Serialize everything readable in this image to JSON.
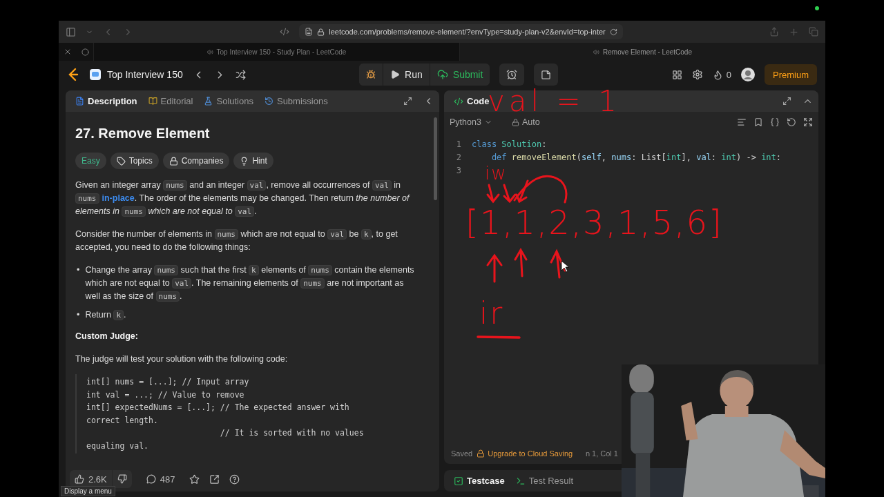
{
  "browser": {
    "url": "leetcode.com/problems/remove-element/?envType=study-plan-v2&envId=top-inter",
    "tabs": [
      {
        "title": "Top Interview 150 - Study Plan - LeetCode",
        "selected": false
      },
      {
        "title": "Remove Element - LeetCode",
        "selected": true
      }
    ]
  },
  "header": {
    "list_title": "Top Interview 150",
    "run": "Run",
    "submit": "Submit",
    "streak": "0",
    "premium": "Premium"
  },
  "description_panel": {
    "tabs": [
      {
        "label": "Description",
        "kind": "description",
        "selected": true
      },
      {
        "label": "Editorial",
        "kind": "editorial",
        "selected": false
      },
      {
        "label": "Solutions",
        "kind": "solutions",
        "selected": false
      },
      {
        "label": "Submissions",
        "kind": "submissions",
        "selected": false
      }
    ],
    "title": "27. Remove Element",
    "tags": [
      {
        "label": "Easy",
        "kind": "difficulty"
      },
      {
        "label": "Topics",
        "kind": "topics"
      },
      {
        "label": "Companies",
        "kind": "companies"
      },
      {
        "label": "Hint",
        "kind": "hint"
      }
    ],
    "paragraphs": [
      [
        {
          "kind": "text",
          "t": "Given an integer array "
        },
        {
          "kind": "code",
          "t": "nums"
        },
        {
          "kind": "text",
          "t": " and an integer "
        },
        {
          "kind": "code",
          "t": "val"
        },
        {
          "kind": "text",
          "t": ", remove all occurrences of "
        },
        {
          "kind": "code",
          "t": "val"
        },
        {
          "kind": "text",
          "t": " in "
        },
        {
          "kind": "code",
          "t": "nums"
        },
        {
          "kind": "link",
          "t": "in-place"
        },
        {
          "kind": "text",
          "t": ". The order of the elements may be changed. Then return "
        },
        {
          "kind": "italic",
          "t": "the number of elements in "
        },
        {
          "kind": "code",
          "t": "nums"
        },
        {
          "kind": "italic",
          "t": " which are not equal to "
        },
        {
          "kind": "code",
          "t": "val"
        },
        {
          "kind": "text",
          "t": "."
        }
      ],
      [
        {
          "kind": "text",
          "t": "Consider the number of elements in "
        },
        {
          "kind": "code",
          "t": "nums"
        },
        {
          "kind": "text",
          "t": " which are not equal to "
        },
        {
          "kind": "code",
          "t": "val"
        },
        {
          "kind": "text",
          "t": " be "
        },
        {
          "kind": "code",
          "t": "k"
        },
        {
          "kind": "text",
          "t": ", to get accepted, you need to do the following things:"
        }
      ]
    ],
    "bullets": [
      {
        "marker": "•",
        "segs": [
          {
            "kind": "text",
            "t": "Change the array "
          },
          {
            "kind": "code",
            "t": "nums"
          },
          {
            "kind": "text",
            "t": " such that the first "
          },
          {
            "kind": "code",
            "t": "k"
          },
          {
            "kind": "text",
            "t": " elements of "
          },
          {
            "kind": "code",
            "t": "nums"
          },
          {
            "kind": "text",
            "t": " contain the elements which are not equal to "
          },
          {
            "kind": "code",
            "t": "val"
          },
          {
            "kind": "text",
            "t": ". The remaining elements of "
          },
          {
            "kind": "code",
            "t": "nums"
          },
          {
            "kind": "text",
            "t": " are not important as well as the size of "
          },
          {
            "kind": "code",
            "t": "nums"
          },
          {
            "kind": "text",
            "t": "."
          }
        ]
      },
      {
        "marker": "•",
        "segs": [
          {
            "kind": "text",
            "t": "Return "
          },
          {
            "kind": "code",
            "t": "k"
          },
          {
            "kind": "text",
            "t": "."
          }
        ]
      }
    ],
    "subheading": "Custom Judge:",
    "judge_intro": "The judge will test your solution with the following code:",
    "judge_code": [
      "int[] nums = [...]; // Input array",
      "int val = ...; // Value to remove",
      "int[] expectedNums = [...]; // The expected answer with",
      "correct length.",
      "                            // It is sorted with no values",
      "equaling val."
    ],
    "likes": "2.6K",
    "comments": "487"
  },
  "code_panel": {
    "tab": "Code",
    "language": "Python3",
    "mode": "Auto",
    "lines": [
      {
        "number": "1",
        "tokens": [
          {
            "kind": "keyword",
            "t": "class "
          },
          {
            "kind": "type",
            "t": "Solution"
          },
          {
            "kind": "plain",
            "t": ":"
          }
        ]
      },
      {
        "number": "2",
        "tokens": [
          {
            "kind": "keyword",
            "t": "    def "
          },
          {
            "kind": "func",
            "t": "removeElement"
          },
          {
            "kind": "plain",
            "t": "("
          },
          {
            "kind": "param",
            "t": "self"
          },
          {
            "kind": "plain",
            "t": ", "
          },
          {
            "kind": "param",
            "t": "nums"
          },
          {
            "kind": "plain",
            "t": ": List["
          },
          {
            "kind": "type",
            "t": "int"
          },
          {
            "kind": "plain",
            "t": "], "
          },
          {
            "kind": "param",
            "t": "val"
          },
          {
            "kind": "plain",
            "t": ": "
          },
          {
            "kind": "type",
            "t": "int"
          },
          {
            "kind": "plain",
            "t": ") -> "
          },
          {
            "kind": "type",
            "t": "int"
          },
          {
            "kind": "plain",
            "t": ":"
          }
        ]
      },
      {
        "number": "3"
      }
    ],
    "saved": "Saved",
    "upgrade": "Upgrade to Cloud Saving",
    "cursor": "n 1, Col 1"
  },
  "annotations": [
    "val = 1",
    "iw",
    "[1,1,2,3,1,5,6]",
    "ir"
  ],
  "bottom_tabs": [
    {
      "label": "Testcase",
      "kind": "testcase",
      "selected": true
    },
    {
      "label": "Test Result",
      "kind": "result",
      "selected": false
    }
  ],
  "tooltip": "Display a menu"
}
